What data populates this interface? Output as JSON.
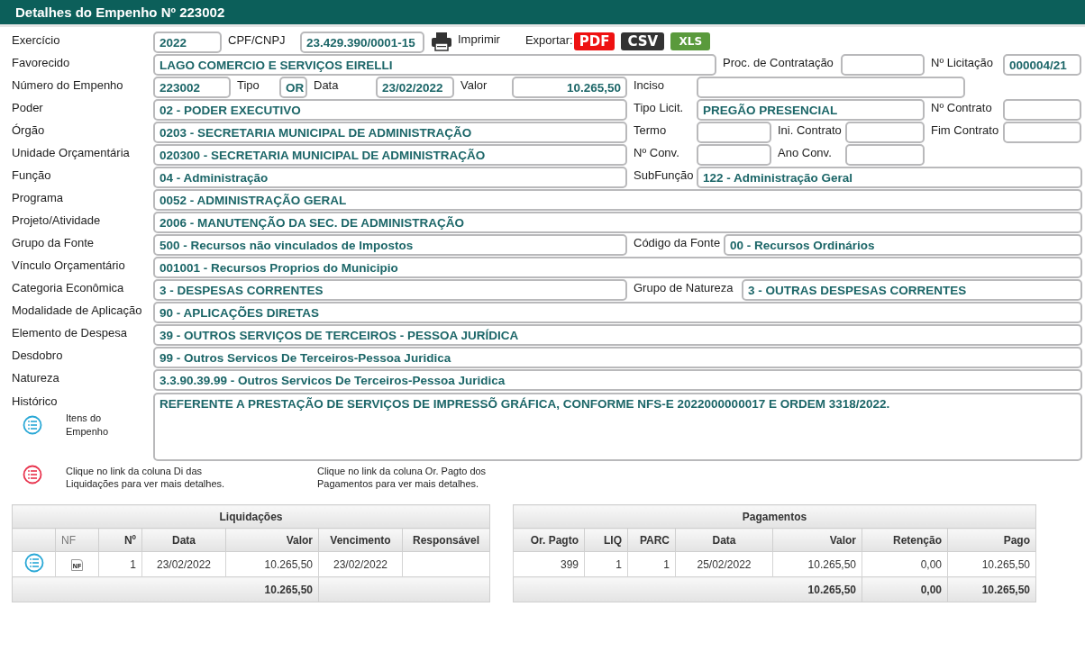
{
  "window": {
    "title": "Detalhes do Empenho Nº 223002"
  },
  "rows": [
    [
      {
        "label": "Exercício",
        "value": "2022"
      },
      {
        "label": "CPF/CNPJ",
        "value": "23.429.390/0001-15"
      }
    ],
    [
      {
        "label": "Favorecido",
        "value": "LAGO COMERCIO E SERVIÇOS EIRELLI"
      },
      {
        "label": "Proc. de Contratação"
      },
      {
        "label": "Nº Licitação",
        "value": "000004/21"
      }
    ],
    [
      {
        "label": "Número do Empenho",
        "value": "223002"
      },
      {
        "label": "Tipo",
        "value": "OR"
      },
      {
        "label": "Data",
        "value": "23/02/2022"
      },
      {
        "label": "Valor",
        "value": "10.265,50"
      },
      {
        "label": "Inciso"
      }
    ],
    [
      {
        "label": "Poder",
        "value": "02 - PODER EXECUTIVO"
      },
      {
        "label": "Tipo Licit.",
        "value": "PREGÃO PRESENCIAL"
      },
      {
        "label": "Nº Contrato"
      }
    ],
    [
      {
        "label": "Órgão",
        "value": "0203 - SECRETARIA MUNICIPAL DE ADMINISTRAÇÃO"
      },
      {
        "label": "Termo"
      },
      {
        "label": "Ini. Contrato"
      },
      {
        "label": "Fim Contrato"
      }
    ],
    [
      {
        "label": "Unidade Orçamentária",
        "value": "020300 - SECRETARIA MUNICIPAL DE ADMINISTRAÇÃO"
      },
      {
        "label": "Nº Conv."
      },
      {
        "label": "Ano Conv."
      }
    ],
    [
      {
        "label": "Função",
        "value": "04 - Administração"
      },
      {
        "label": "SubFunção",
        "value": "122 - Administração Geral"
      }
    ],
    [
      {
        "label": "Programa",
        "value": "0052 - ADMINISTRAÇÃO GERAL"
      }
    ],
    [
      {
        "label": "Projeto/Atividade",
        "value": "2006 - MANUTENÇÃO DA SEC. DE ADMINISTRAÇÃO"
      }
    ],
    [
      {
        "label": "Grupo da Fonte",
        "value": "500 - Recursos não vinculados de Impostos"
      },
      {
        "label": "Código da Fonte",
        "value": "00 - Recursos Ordinários"
      }
    ],
    [
      {
        "label": "Vínculo Orçamentário",
        "value": "001001 - Recursos Proprios do Municipio"
      }
    ],
    [
      {
        "label": "Categoria Econômica",
        "value": "3 - DESPESAS CORRENTES"
      },
      {
        "label": "Grupo de Natureza",
        "value": "3 - OUTRAS DESPESAS CORRENTES"
      }
    ],
    [
      {
        "label": "Modalidade de Aplicação",
        "value": "90 - APLICAÇÕES DIRETAS"
      }
    ],
    [
      {
        "label": "Elemento de Despesa",
        "value": "39 - OUTROS SERVIÇOS DE TERCEIROS - PESSOA JURÍDICA"
      }
    ],
    [
      {
        "label": "Desdobro",
        "value": "99 - Outros Servicos De Terceiros-Pessoa Juridica"
      }
    ],
    [
      {
        "label": "Natureza",
        "value": "3.3.90.39.99 - Outros Servicos De Terceiros-Pessoa Juridica"
      }
    ]
  ],
  "print": {
    "label": "Imprimir"
  },
  "export": {
    "label": "Exportar:",
    "buttons": [
      {
        "kind": "pdf",
        "label": "PDF"
      },
      {
        "kind": "csv",
        "label": "CSV"
      },
      {
        "kind": "xls",
        "label": "XLS"
      }
    ]
  },
  "historico": {
    "label": "Histórico",
    "value": "REFERENTE A PRESTAÇÃO DE SERVIÇOS DE IMPRESSÕ GRÁFICA, CONFORME NFS-E 2022000000017 E ORDEM 3318/2022."
  },
  "itens_link": "Itens do Empenho",
  "notes": [
    "Clique no link da coluna Di das Liquidações para ver mais detalhes.",
    "Clique no link da coluna Or. Pagto dos Pagamentos para ver mais detalhes."
  ],
  "liquidacoes": {
    "title": "Liquidações",
    "columns": [
      "NF",
      "Nº",
      "Data",
      "Valor",
      "Vencimento",
      "Responsável"
    ],
    "rows": [
      {
        "nf": "NF",
        "values": [
          "1",
          "23/02/2022",
          "10.265,50",
          "23/02/2022"
        ]
      }
    ],
    "totals": [
      "10.265,50"
    ]
  },
  "pagamentos": {
    "title": "Pagamentos",
    "columns": [
      "Or. Pagto",
      "LIQ",
      "PARC",
      "Data",
      "Valor",
      "Retenção",
      "Pago"
    ],
    "rows": [
      {
        "values": [
          "399",
          "1",
          "1",
          "25/02/2022",
          "10.265,50",
          "0,00",
          "10.265,50"
        ]
      }
    ],
    "totals": [
      "10.265,50",
      "0,00",
      "10.265,50"
    ]
  }
}
